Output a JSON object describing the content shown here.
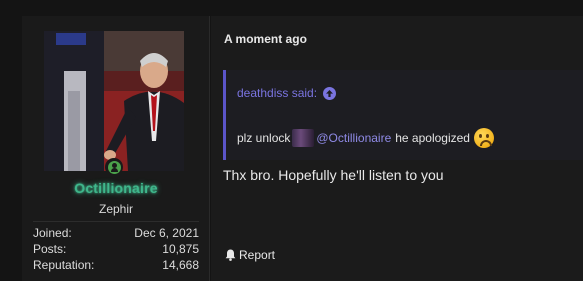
{
  "post": {
    "timestamp": "A moment ago",
    "quote": {
      "author_said": "deathdiss said:",
      "text_before": "plz unlock",
      "mention": "@Octillionaire",
      "text_after": "he apologized"
    },
    "message": "Thx bro. Hopefully he'll listen to you",
    "report_label": "Report"
  },
  "user": {
    "username": "Octillionaire",
    "title": "Zephir",
    "stats": [
      {
        "label": "Joined:",
        "value": "Dec 6, 2021"
      },
      {
        "label": "Posts:",
        "value": "10,875"
      },
      {
        "label": "Reputation:",
        "value": "14,668"
      }
    ]
  },
  "colors": {
    "username_glow": "#3fb68b",
    "quote_accent": "#5b55c9",
    "mention": "#8f8ae6",
    "online": "#4ba24b"
  },
  "icons": {
    "online": "person-online-icon",
    "quote_jump": "arrow-up-circle-icon",
    "report": "bell-icon",
    "emoji": "frowning-face-emoji"
  }
}
